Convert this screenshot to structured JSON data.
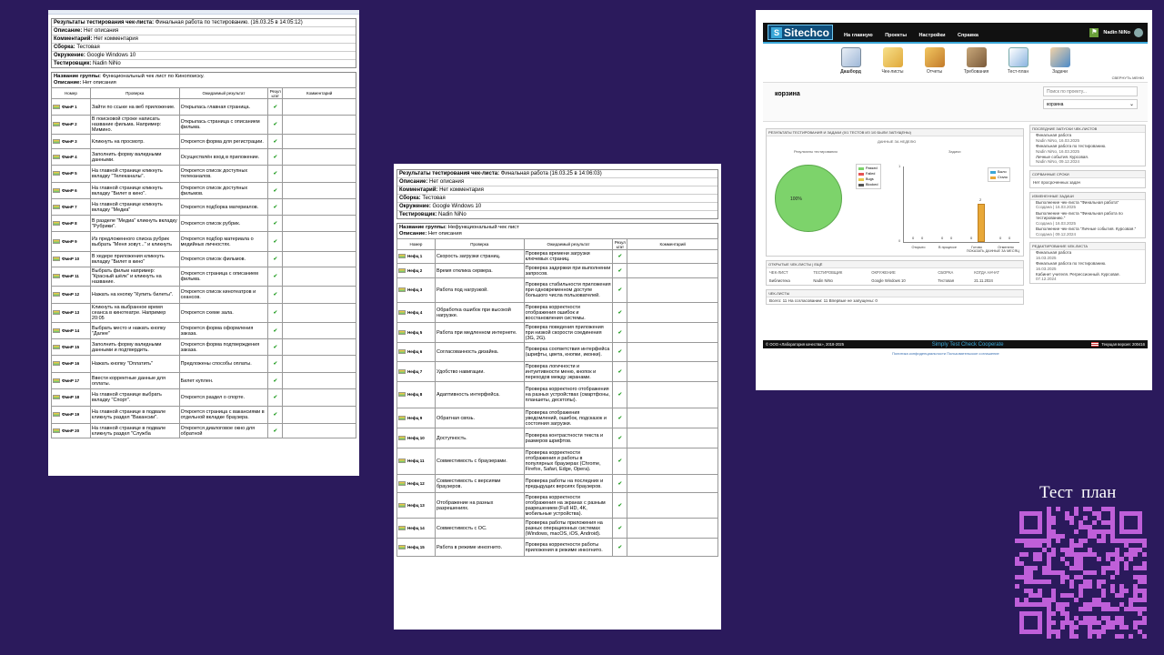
{
  "p1": {
    "header": [
      {
        "label": "Результаты тестирования чек-листа:",
        "value": "Финальная работа по тестированию. (16.03.25 в 14:05:12)"
      },
      {
        "label": "Описание:",
        "value": "Нет описания"
      },
      {
        "label": "Комментарий:",
        "value": "Нет комментария"
      },
      {
        "label": "Сборка:",
        "value": "Тестовая"
      },
      {
        "label": "Окружение:",
        "value": "Google Windows 10"
      },
      {
        "label": "Тестировщик:",
        "value": "Nadin NiNo"
      }
    ],
    "group": {
      "label": "Название группы:",
      "value": "Функциональный чек лист по Кинопоиску.",
      "desc_label": "Описание:",
      "desc": "Нет описания"
    },
    "columns": [
      "Номер",
      "Проверка",
      "Ожидаемый результат",
      "Резул ьтат",
      "Комментарий"
    ],
    "rows": [
      [
        "ФмнР 1",
        "Зайти по ссыке на веб приложение.",
        "Открылась главная страница."
      ],
      [
        "ФмнР 2",
        "В поисковой строке написать название фильма. Например: Мимино.",
        "Открылась страница с описанием фильма."
      ],
      [
        "ФмнР 3",
        "Кликнуть на просмотр.",
        "Откроется форма для регистрации."
      ],
      [
        "ФмнР 4",
        "Заполнить форму валидными данными.",
        "Осуществлён вход в приложение."
      ],
      [
        "ФмнР 5",
        "На главной странице кликнуть вкладку \"Телеканалы\".",
        "Откроется список доступных телеканалов."
      ],
      [
        "ФмнР 6",
        "На главной странице кликнуть вкладку \"Билет в кино\".",
        "Откроется список доступных фильмов."
      ],
      [
        "ФмнР 7",
        "На главной странице кликнуть вкладку \"Медиа\"",
        "Откроется подборка материалов."
      ],
      [
        "ФмнР 8",
        "В разделе \"Медиа\" кликнуть вкладку \"Рубрики\".",
        "Откроется список рубрик."
      ],
      [
        "ФмнР 9",
        "Из предложенного списка рубрик выбрать \"Меня зовут...\" и кликнуть",
        "Откроется подбор материала о медийных личностях."
      ],
      [
        "ФмнР 10",
        "В хедере приложения кликнуть вкладку \"Билет в кино\"",
        "Откроется список фильмов."
      ],
      [
        "ФмнР 11",
        "Выбрать фильм например: \"Красный шёлк\" и кликнуть на название.",
        "Откроется страница с описанием фильма."
      ],
      [
        "ФмнР 12",
        "Нажать на кнопку \"Купить билеты\".",
        "Откроется список кинотеатров и сеансов."
      ],
      [
        "ФмнР 13",
        "Кликнуть на выбранное время сеанса в кинотеатре. Например 20:05",
        "Откроется схеме зала."
      ],
      [
        "ФмнР 14",
        "Выбрать место и нажать кнопку \"Далее\"",
        "Откроется форма оформления заказа."
      ],
      [
        "ФмнР 15",
        "Заполнить форму валидными данными и подтвердить.",
        "Откроется форма подтверждения заказа."
      ],
      [
        "ФмнР 16",
        "Нажать кнопку \"Оплатить\"",
        "Предложены способы оплаты."
      ],
      [
        "ФмнР 17",
        "Ввести корректные данные для оплаты.",
        "Билет куплен."
      ],
      [
        "ФмнР 18",
        "На главной странице выбрать вкладку \"Спорт\".",
        "Откроется раздел о спорте."
      ],
      [
        "ФмнР 19",
        "На главной странице в подвале кликнуть раздел \"Вакансии\".",
        "Откроется страница с вакансиями в отдельной вкладке браузера."
      ],
      [
        "ФмнР 20",
        "На главной странице в подвале кликнуть раздел \"Служба",
        "Откроется диалоговое окно для обратной"
      ]
    ]
  },
  "p2": {
    "header": [
      {
        "label": "Результаты тестирования чек-листа:",
        "value": "Финальная работа (16.03.25 в 14:06:03)"
      },
      {
        "label": "Описание:",
        "value": "Нет описания"
      },
      {
        "label": "Комментарий:",
        "value": "Нет комментария"
      },
      {
        "label": "Сборка:",
        "value": "Тестовая"
      },
      {
        "label": "Окружение:",
        "value": "Google Windows 10"
      },
      {
        "label": "Тестировщик:",
        "value": "Nadin NiNo"
      }
    ],
    "group": {
      "label": "Название группы:",
      "value": "Нефункциональный чек лист",
      "desc_label": "Описание:",
      "desc": "Нет описания"
    },
    "columns": [
      "Номер",
      "Проверка",
      "Ожидаемый результат",
      "Резул ьтат",
      "Комментарий"
    ],
    "rows": [
      [
        "Нефц 1",
        "Скорость загрузки страниц.",
        "Проверка времени загрузки ключевых страниц."
      ],
      [
        "Нефц 2",
        "Время отклика сервера.",
        "Проверка задержки при выполнении запросов."
      ],
      [
        "Нефц 3",
        "Работа под нагрузкой.",
        "Проверка стабильности приложения при одновременном доступе большого числа пользователей."
      ],
      [
        "Нефц 4",
        "Обработка ошибок при высокой нагрузке.",
        "Проверка корректности отображения ошибок и восстановления системы."
      ],
      [
        "Нефц 5",
        "Работа при медленном интернете.",
        "Проверка поведения приложения при низкой скорости соединения (3G, 2G)."
      ],
      [
        "Нефц 6",
        "Согласованность дизайна.",
        "Проверка соответствия интерфейса (шрифты, цвета, кнопки, иконки)."
      ],
      [
        "Нефц 7",
        "Удобство навигации.",
        "Проверка логичности и интуитивности меню, кнопок и переходов между экранами."
      ],
      [
        "Нефц 8",
        "Адаптивность интерфейса.",
        "Проверка корректного отображения на разных устройствах (смартфоны, планшеты, десктопы)."
      ],
      [
        "Нефц 9",
        "Обратная связь.",
        "Проверка отображения уведомлений, ошибок, подсказок и состояния загрузки."
      ],
      [
        "Нефц 10",
        "Доступность.",
        "Проверка контрастности текста и размеров шрифтов."
      ],
      [
        "Нефц 11",
        "Совместимость с браузерами.",
        "Проверка корректности отображения и работы в популярных браузерах (Chrome, Firefox, Safari, Edge, Opera)."
      ],
      [
        "Нефц 12",
        "Совместимость с версиями браузеров.",
        "Проверка работы на последних и предыдущих версиях браузеров."
      ],
      [
        "Нефц 13",
        "Отображение на разных разрешениях.",
        "Проверка корректности отображения на экранах с разным разрешением (Full HD, 4K, мобильные устройства)."
      ],
      [
        "Нефц 14",
        "Совместимость с ОС.",
        "Проверка работы приложения на разных операционных системах (Windows, macOS, iOS, Android)."
      ],
      [
        "Нефц 15",
        "Работа в режиме инкогнито.",
        "Проверка корректности работы приложения в режиме инкогнито."
      ]
    ]
  },
  "p3": {
    "logo": "Sitechco",
    "logo_mark": "S",
    "nav": [
      "На главную",
      "Проекты",
      "Настройки",
      "Справка"
    ],
    "user": "Nadin NiNo",
    "toolbar": [
      "Дашборд",
      "Чек-листы",
      "Отчеты",
      "Требования",
      "Тест-план",
      "Задачи"
    ],
    "collapse": "СВЕРНУТЬ МЕНЮ",
    "project": "корзина",
    "search_placeholder": "Поиск по проекту...",
    "select_value": "корзина",
    "results_title": "РЕЗУЛЬТАТЫ ТЕСТИРОВАНИЯ И ЗАДАЧИ (0/1 ТЕСТОВ ИЗ 1/0 БЫЛИ ЗАПУЩЕНЫ)",
    "week_title": "ДАННЫЕ ЗА НЕДЕЛЮ",
    "pie_title": "Результаты тестирования",
    "pie_label": "100%",
    "pie_legend": [
      {
        "name": "Passed",
        "color": "#7dd36b"
      },
      {
        "name": "Failed",
        "color": "#e55353"
      },
      {
        "name": "Bugs",
        "color": "#e8c84a"
      },
      {
        "name": "Blocked",
        "color": "#555555"
      }
    ],
    "tasks_title": "Задачи",
    "tasks_legend": [
      {
        "name": "Было",
        "color": "#3aa7d8"
      },
      {
        "name": "Стало",
        "color": "#e8a838"
      }
    ],
    "tasks_y": [
      "1",
      "0"
    ],
    "tasks_categories": [
      "Открыто",
      "В процессе",
      "Готово",
      "Отменено"
    ],
    "tasks_values": [
      "0",
      "0",
      "0",
      "0",
      "0",
      "2",
      "0",
      "0"
    ],
    "show_month": "ПОКАЗАТЬ ДАННЫЕ ЗА МЕСЯЦ",
    "open_title": "ОТКРЫТЫЕ ЧЕК-ЛИСТЫ | ЕЩЁ",
    "open_cols": [
      "ЧЕК-ЛИСТ",
      "ТЕСТИРОВЩИК",
      "ОКРУЖЕНИЕ",
      "СБОРКА",
      "КОГДА НАЧАТ"
    ],
    "open_row": [
      "Библиотека",
      "Nadin NiNo",
      "Google Windows 10",
      "Тестовая",
      "21.11.2024"
    ],
    "cl_title": "ЧЕК-ЛИСТЫ",
    "cl_stats": "Всего: 11     На согласовании: 11     Впервые не запущены: 0",
    "last_title": "ПОСЛЕДНИЕ ЗАПУСКИ ЧЕК-ЛИСТОВ",
    "last": [
      {
        "t": "Финальная работа",
        "s": "Nadin NiNo, 16.03.2025"
      },
      {
        "t": "Финальная работа по тестированию.",
        "s": "Nadin NiNo, 16.03.2025"
      },
      {
        "t": "Личные события. Курсовая.",
        "s": "Nadin NiNo, 09.12.2024"
      }
    ],
    "deadline_title": "СОРВАННЫЕ СРОКИ",
    "deadline": "Нет просроченных задач",
    "changed_title": "ИЗМЕНЕННЫЕ ЗАДАЧИ",
    "changed": [
      {
        "t": "Выполнение чек-листа \"Финальная работа\"",
        "s": "Создана | 16.03.2025"
      },
      {
        "t": "Выполнение чек-листа \"Финальная работа по тестированию.\"",
        "s": "Создана | 16.03.2025"
      },
      {
        "t": "Выполнение чек-листа \"Личные события. Курсовая.\"",
        "s": "Создана | 09.12.2024"
      }
    ],
    "edit_title": "РЕДАКТИРОВАНИЕ ЧЕК-ЛИСТА",
    "edit": [
      {
        "t": "Финальная работа",
        "s": "16.03.2025"
      },
      {
        "t": "Финальная работа по тестированию.",
        "s": "16.03.2025"
      },
      {
        "t": "Кабинет учителя. Регрессионный. Курсовая.",
        "s": "07.12.2024"
      }
    ],
    "footer_left": "© ООО «Лаборатория качества», 2018-2025",
    "footer_mid": "Simply Test Check Cooperate",
    "footer_right": "Текущая версия: 200416",
    "footer_links": "Политика конфиденциальности   Пользовательское соглашение"
  },
  "side": {
    "title": "Тест  план"
  }
}
